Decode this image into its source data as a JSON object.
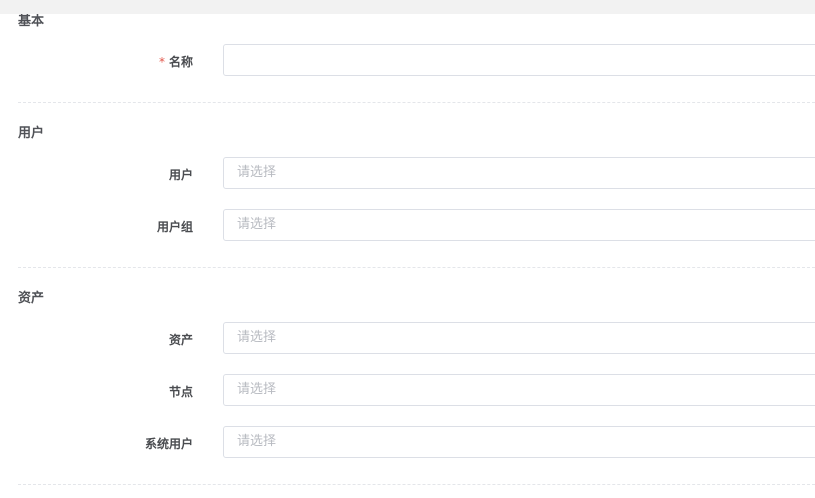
{
  "sections": {
    "basic": {
      "title": "基本",
      "name_label": "名称",
      "required_mark": "*",
      "name_value": ""
    },
    "user": {
      "title": "用户",
      "user_label": "用户",
      "user_placeholder": "请选择",
      "group_label": "用户组",
      "group_placeholder": "请选择"
    },
    "asset": {
      "title": "资产",
      "asset_label": "资产",
      "asset_placeholder": "请选择",
      "node_label": "节点",
      "node_placeholder": "请选择",
      "system_user_label": "系统用户",
      "system_user_placeholder": "请选择"
    }
  }
}
